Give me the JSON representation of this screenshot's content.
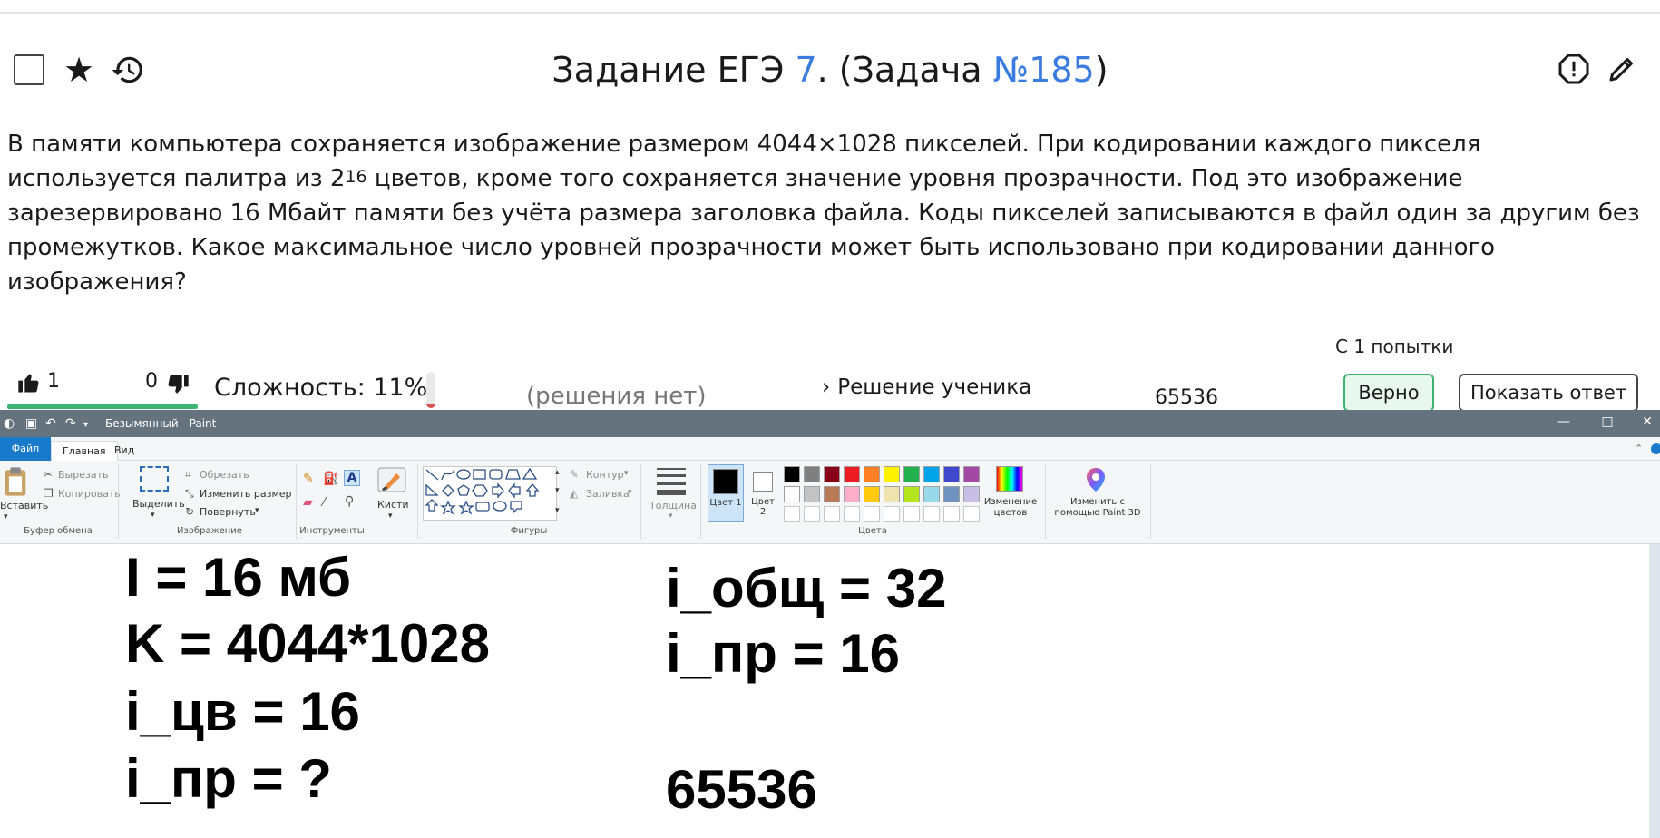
{
  "task": {
    "title_prefix": "Задание ЕГЭ",
    "task_number": "7",
    "title_mid": ". (Задача",
    "problem_number": "№185",
    "title_suffix": ")",
    "text_part1": "В памяти компьютера сохраняется изображение размером 4044×1028 пикселей. При кодировании каждого пикселя используется палитра из 2",
    "text_sup": "16",
    "text_part2": " цветов, кроме того сохраняется значение уровня прозрачности. Под это изображение зарезервировано 16 Мбайт памяти без учёта размера заголовка файла. Коды пикселей записываются в файл один за другим без промежутков. Какое максимальное число уровней прозрачности может быть использовано при кодировании данного изображения?"
  },
  "stats": {
    "attempts": "С 1 попытки",
    "likes": "1",
    "dislikes": "0",
    "difficulty": "Сложность: 11%",
    "difficulty_level": 0.11,
    "no_solutions": "(решения нет)",
    "student_solution": "Решение ученика",
    "answer_value": "65536",
    "correct_label": "Верно",
    "show_answer_label": "Показать ответ"
  },
  "paint": {
    "window_title": "Безымянный - Paint",
    "tabs": {
      "file": "Файл",
      "home": "Главная",
      "view": "Вид"
    },
    "clipboard": {
      "paste": "Вставить",
      "cut": "Вырезать",
      "copy": "Копировать",
      "group": "Буфер обмена"
    },
    "image": {
      "select": "Выделить",
      "crop": "Обрезать",
      "resize": "Изменить размер",
      "rotate": "Повернуть",
      "group": "Изображение"
    },
    "tools": {
      "group": "Инструменты"
    },
    "brushes": {
      "label": "Кисти"
    },
    "shapes": {
      "outline": "Контур",
      "fill": "Заливка",
      "group": "Фигуры"
    },
    "size": {
      "label": "Толщина"
    },
    "colors": {
      "color1": "Цвет 1",
      "color2": "Цвет 2",
      "edit": "Изменение цветов",
      "paint3d": "Изменить с помощью Paint 3D",
      "group": "Цвета",
      "primary": "#000000",
      "secondary": "#ffffff",
      "palette_row1": [
        "#000000",
        "#7f7f7f",
        "#880015",
        "#ed1c24",
        "#ff7f27",
        "#fff200",
        "#22b14c",
        "#00a2e8",
        "#3f48cc",
        "#a349a4"
      ],
      "palette_row2": [
        "#ffffff",
        "#c3c3c3",
        "#b97a57",
        "#ffaec9",
        "#ffc90e",
        "#efe4b0",
        "#b5e61d",
        "#99d9ea",
        "#7092be",
        "#c8bfe7"
      ]
    },
    "canvas": {
      "left_lines": [
        "I = 16 мб",
        "K = 4044*1028",
        "i_цв = 16",
        "i_пр = ?"
      ],
      "right_lines": [
        "i_общ = 32",
        "i_пр = 16",
        "65536"
      ]
    }
  }
}
